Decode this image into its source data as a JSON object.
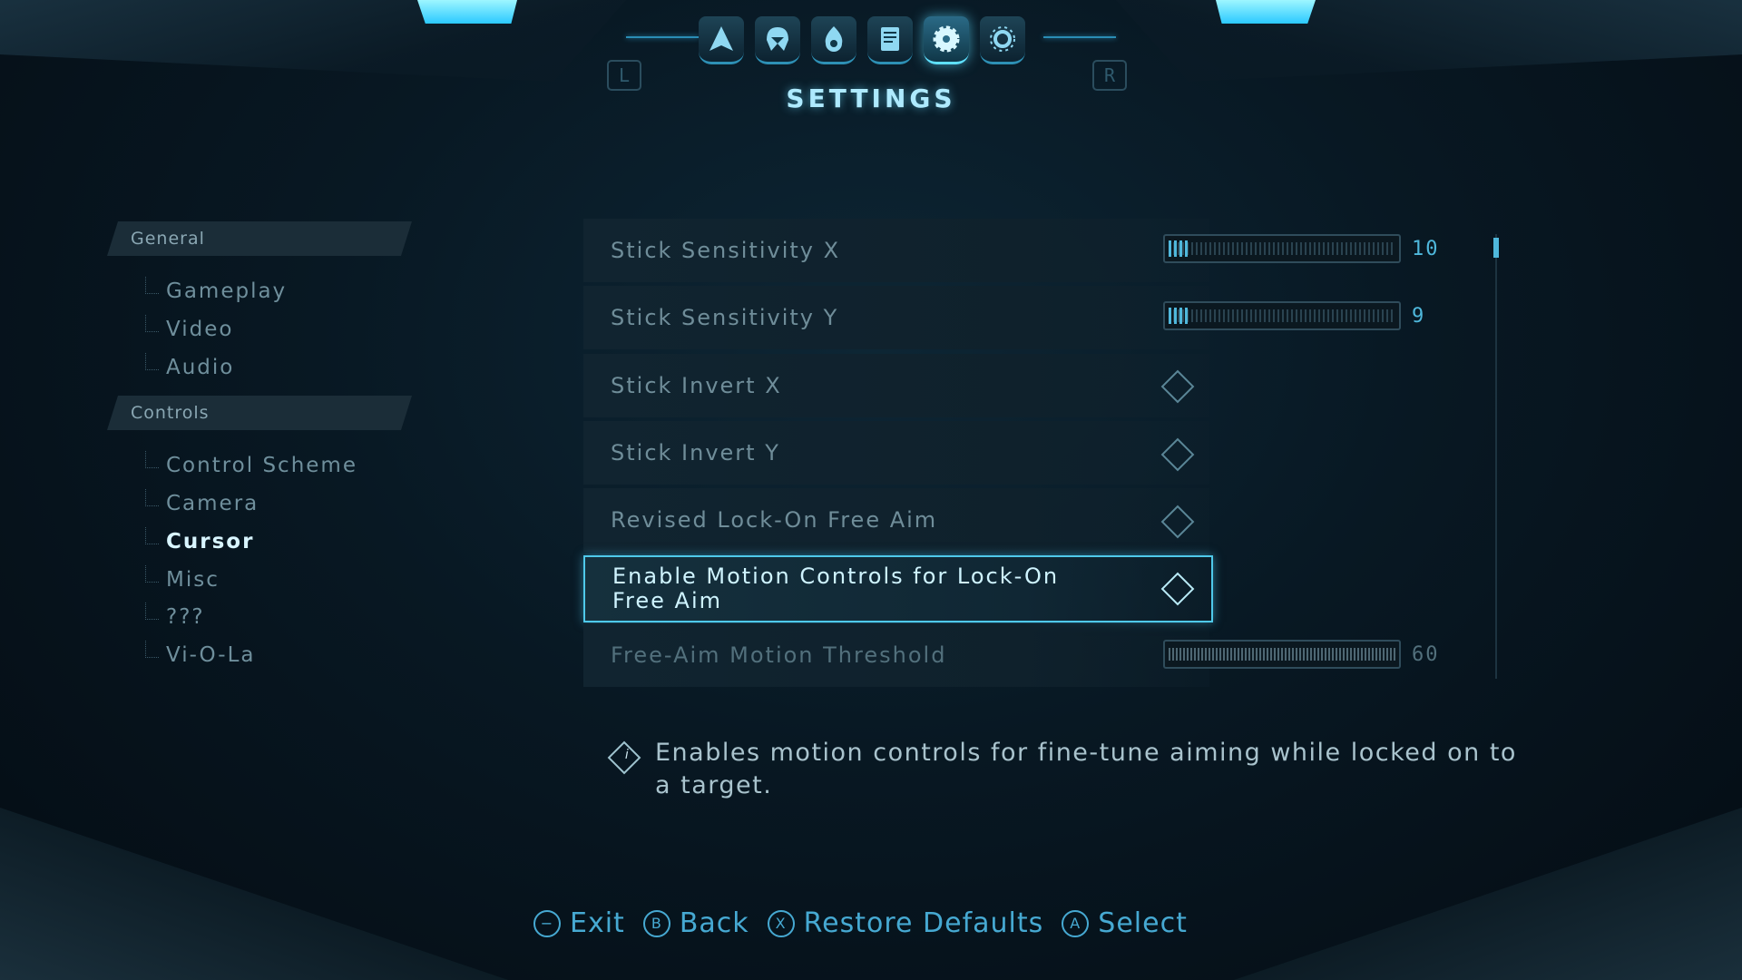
{
  "header": {
    "title": "SETTINGS",
    "left_shoulder": "L",
    "right_shoulder": "R",
    "tabs": [
      {
        "icon": "ship-icon"
      },
      {
        "icon": "helmet-icon"
      },
      {
        "icon": "flame-icon"
      },
      {
        "icon": "logbook-icon"
      },
      {
        "icon": "gear-icon",
        "active": true
      },
      {
        "icon": "options-icon"
      }
    ]
  },
  "sidebar": {
    "groups": [
      {
        "label": "General",
        "items": [
          "Gameplay",
          "Video",
          "Audio"
        ]
      },
      {
        "label": "Controls",
        "items": [
          "Control Scheme",
          "Camera",
          "Cursor",
          "Misc",
          "???",
          "Vi-O-La"
        ]
      }
    ],
    "active_item": "Cursor"
  },
  "settings": {
    "rows": [
      {
        "label": "Stick Sensitivity X",
        "type": "slider",
        "value": "10",
        "fill_fraction": 0.08
      },
      {
        "label": "Stick Sensitivity Y",
        "type": "slider",
        "value": "9",
        "fill_fraction": 0.08
      },
      {
        "label": "Stick Invert X",
        "type": "checkbox",
        "checked": false
      },
      {
        "label": "Stick Invert Y",
        "type": "checkbox",
        "checked": false
      },
      {
        "label": "Revised Lock-On Free Aim",
        "type": "checkbox",
        "checked": false
      },
      {
        "label": "Enable Motion Controls for Lock-On Free Aim",
        "type": "checkbox",
        "checked": false,
        "selected": true
      },
      {
        "label": "Free-Aim Motion Threshold",
        "type": "slider",
        "value": "60",
        "disabled": true
      }
    ]
  },
  "description": {
    "icon": "info-icon",
    "text": "Enables motion controls for fine-tune aiming while locked on to a target."
  },
  "footer": {
    "hints": [
      {
        "button": "−",
        "label": "Exit"
      },
      {
        "button": "B",
        "label": "Back"
      },
      {
        "button": "X",
        "label": "Restore Defaults"
      },
      {
        "button": "A",
        "label": "Select"
      }
    ]
  },
  "colors": {
    "accent": "#4fb8dc",
    "title_glow": "#aeeaff",
    "selected_border": "#4fc9ea"
  }
}
